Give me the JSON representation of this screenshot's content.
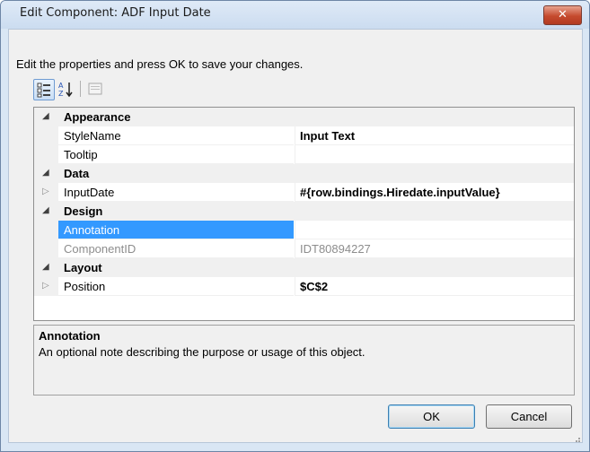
{
  "window": {
    "title": "Edit Component: ADF Input Date",
    "close_symbol": "✕"
  },
  "instruction": "Edit the properties and press OK to save your changes.",
  "toolbar": {
    "categorized_icon": "categorized-icon",
    "alphabetical_icon": "alphabetical-sort-icon",
    "property_pages_icon": "property-pages-icon"
  },
  "grid": {
    "categories": [
      {
        "label": "Appearance",
        "properties": [
          {
            "name": "StyleName",
            "value": "Input Text"
          },
          {
            "name": "Tooltip",
            "value": ""
          }
        ]
      },
      {
        "label": "Data",
        "properties": [
          {
            "name": "InputDate",
            "value": "#{row.bindings.Hiredate.inputValue}"
          }
        ]
      },
      {
        "label": "Design",
        "properties": [
          {
            "name": "Annotation",
            "value": ""
          },
          {
            "name": "ComponentID",
            "value": "IDT80894227"
          }
        ]
      },
      {
        "label": "Layout",
        "properties": [
          {
            "name": "Position",
            "value": "$C$2"
          }
        ]
      }
    ]
  },
  "help": {
    "title": "Annotation",
    "description": "An optional note describing the purpose or usage of this object."
  },
  "buttons": {
    "ok": "OK",
    "cancel": "Cancel"
  },
  "colors": {
    "selection": "#3399ff",
    "close_button": "#c54a2e"
  }
}
